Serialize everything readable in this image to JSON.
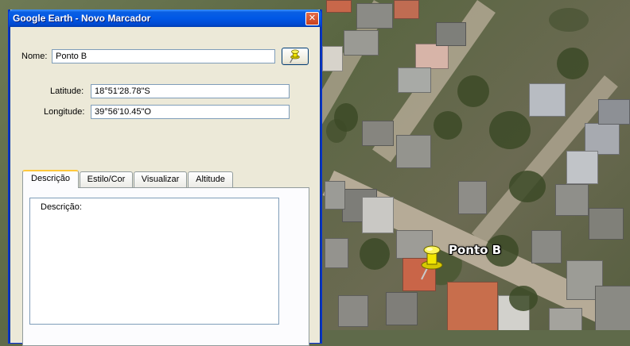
{
  "dialog": {
    "title": "Google Earth - Novo Marcador",
    "close_symbol": "✕",
    "name_label": "Nome:",
    "name_value": "Ponto B",
    "pin_icon": "yellow-pushpin-icon",
    "latitude_label": "Latitude:",
    "latitude_value": "18°51'28.78\"S",
    "longitude_label": "Longitude:",
    "longitude_value": "39°56'10.45\"O",
    "tabs": [
      {
        "label": "Descrição",
        "active": true
      },
      {
        "label": "Estilo/Cor",
        "active": false
      },
      {
        "label": "Visualizar",
        "active": false
      },
      {
        "label": "Altitude",
        "active": false
      }
    ],
    "description_label": "Descrição:",
    "description_value": ""
  },
  "map": {
    "placemark_label": "Ponto B",
    "placemark_icon": "yellow-pushpin-icon"
  },
  "colors": {
    "titlebar": "#0058e6",
    "dialog_bg": "#ece9d8",
    "active_tab_accent": "#ffc83c",
    "pin": "#f2e600"
  }
}
